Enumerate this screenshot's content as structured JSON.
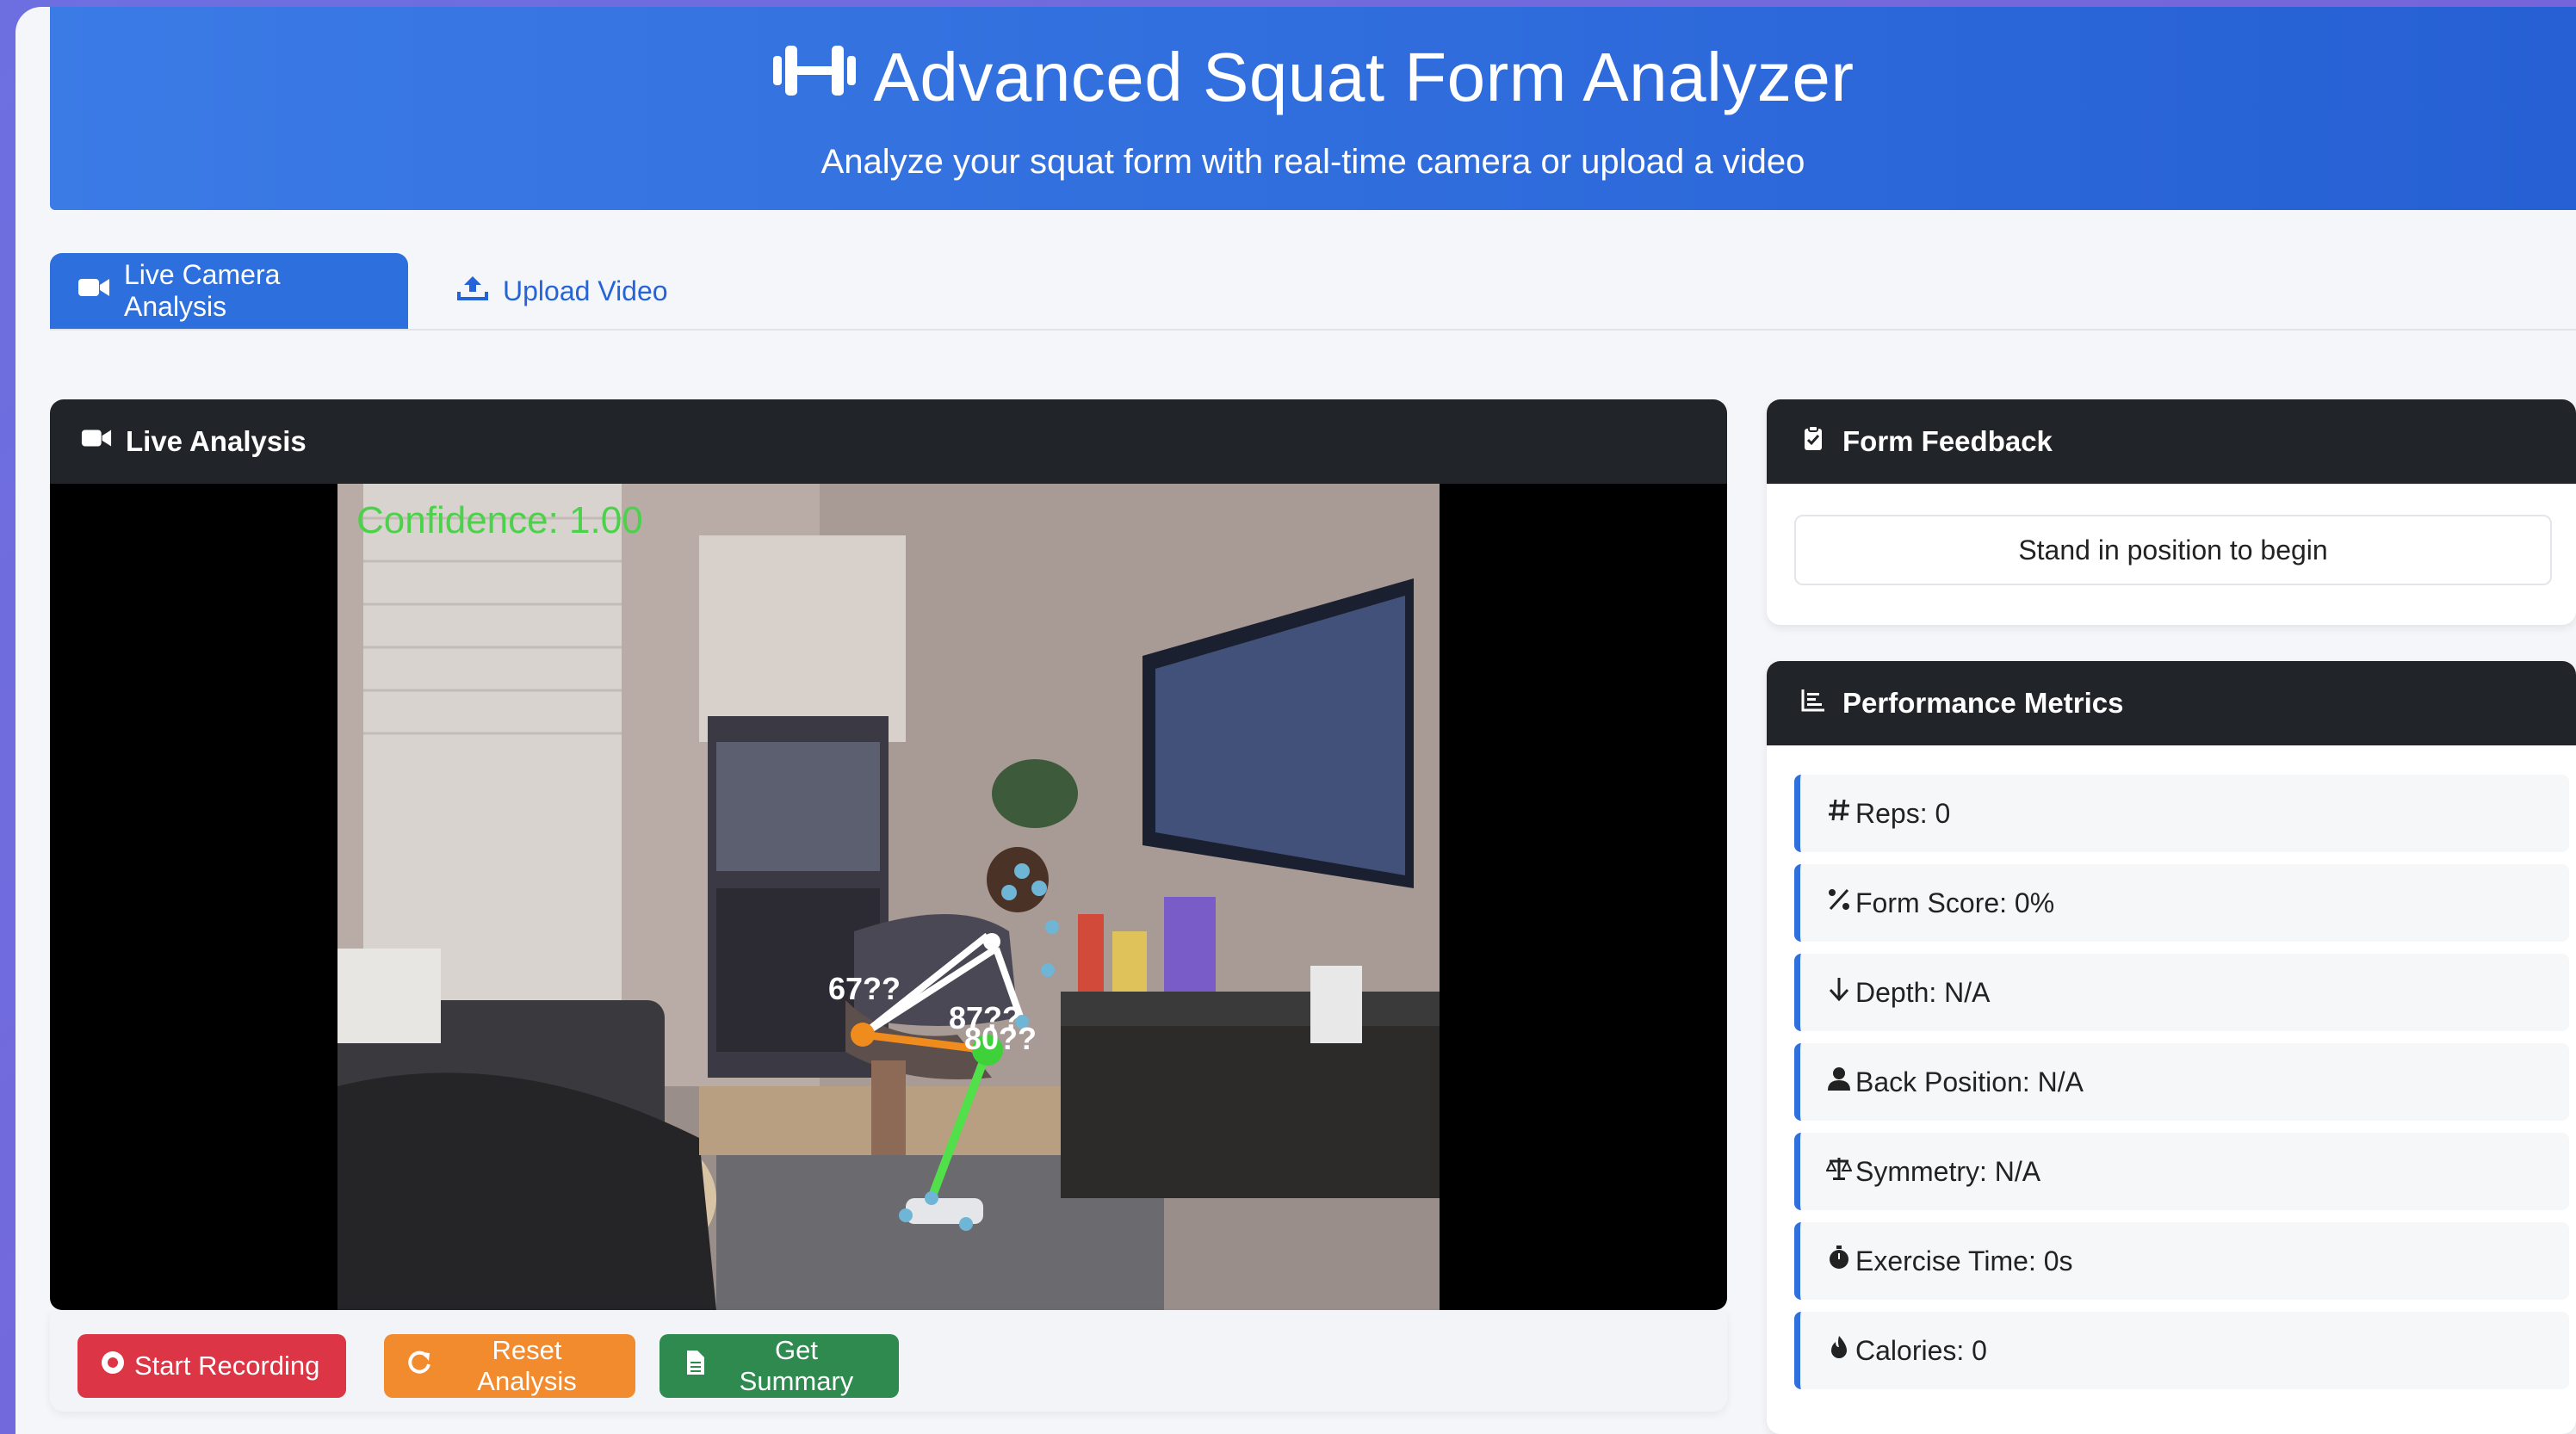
{
  "header": {
    "title": "Advanced Squat Form Analyzer",
    "subtitle": "Analyze your squat form with real-time camera or upload a video",
    "icon": "dumbbell-icon"
  },
  "tabs": [
    {
      "label": "Live Camera Analysis",
      "icon": "video-icon",
      "active": true
    },
    {
      "label": "Upload Video",
      "icon": "upload-icon",
      "active": false
    }
  ],
  "live_panel": {
    "title": "Live Analysis",
    "overlay": {
      "confidence_text": "Confidence: 1.00",
      "angle_labels": [
        "67??",
        "87??",
        "80??"
      ]
    }
  },
  "controls": {
    "start_recording": "Start Recording",
    "reset_analysis": "Reset Analysis",
    "get_summary": "Get Summary"
  },
  "feedback": {
    "title": "Form Feedback",
    "message": "Stand in position to begin"
  },
  "metrics": {
    "title": "Performance Metrics",
    "items": [
      {
        "icon": "hashtag-icon",
        "label": "Reps: 0"
      },
      {
        "icon": "percent-icon",
        "label": "Form Score: 0%"
      },
      {
        "icon": "arrow-down-icon",
        "label": "Depth: N/A"
      },
      {
        "icon": "user-icon",
        "label": "Back Position: N/A"
      },
      {
        "icon": "balance-scale-icon",
        "label": "Symmetry: N/A"
      },
      {
        "icon": "stopwatch-icon",
        "label": "Exercise Time: 0s"
      },
      {
        "icon": "fire-icon",
        "label": "Calories: 0"
      }
    ]
  },
  "colors": {
    "header_blue": "#2d6fdd",
    "panel_dark": "#212529",
    "confidence_green": "#4cd24a",
    "btn_red": "#dc3545",
    "btn_orange": "#f28a2e",
    "btn_green": "#2e8a4e",
    "metric_accent": "#2f6fde"
  }
}
